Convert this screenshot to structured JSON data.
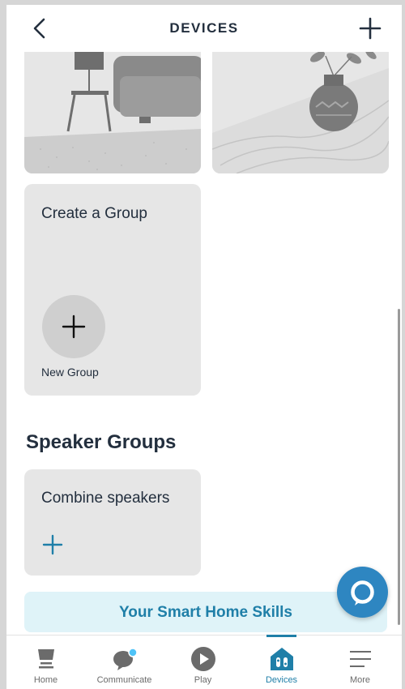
{
  "header": {
    "title": "DEVICES",
    "back_icon": "chevron-left-icon",
    "add_icon": "plus-icon"
  },
  "create_group": {
    "title": "Create a Group",
    "new_group_label": "New Group",
    "icon": "plus-icon"
  },
  "speaker_groups": {
    "section_title": "Speaker Groups",
    "combine_title": "Combine speakers",
    "icon": "plus-icon"
  },
  "skills": {
    "label": "Your Smart Home Skills"
  },
  "alexa": {
    "icon": "alexa-ring-icon"
  },
  "nav": {
    "items": [
      {
        "label": "Home",
        "icon": "home-icon",
        "active": false
      },
      {
        "label": "Communicate",
        "icon": "chat-bubble-icon",
        "active": false
      },
      {
        "label": "Play",
        "icon": "play-icon",
        "active": false
      },
      {
        "label": "Devices",
        "icon": "devices-house-icon",
        "active": true
      },
      {
        "label": "More",
        "icon": "menu-lines-icon",
        "active": false
      }
    ]
  },
  "colors": {
    "accent": "#1f7fa8",
    "alexa": "#2e86c1",
    "card_bg": "#e6e6e6",
    "skills_bg": "#dff3f8",
    "text": "#232f3e"
  }
}
